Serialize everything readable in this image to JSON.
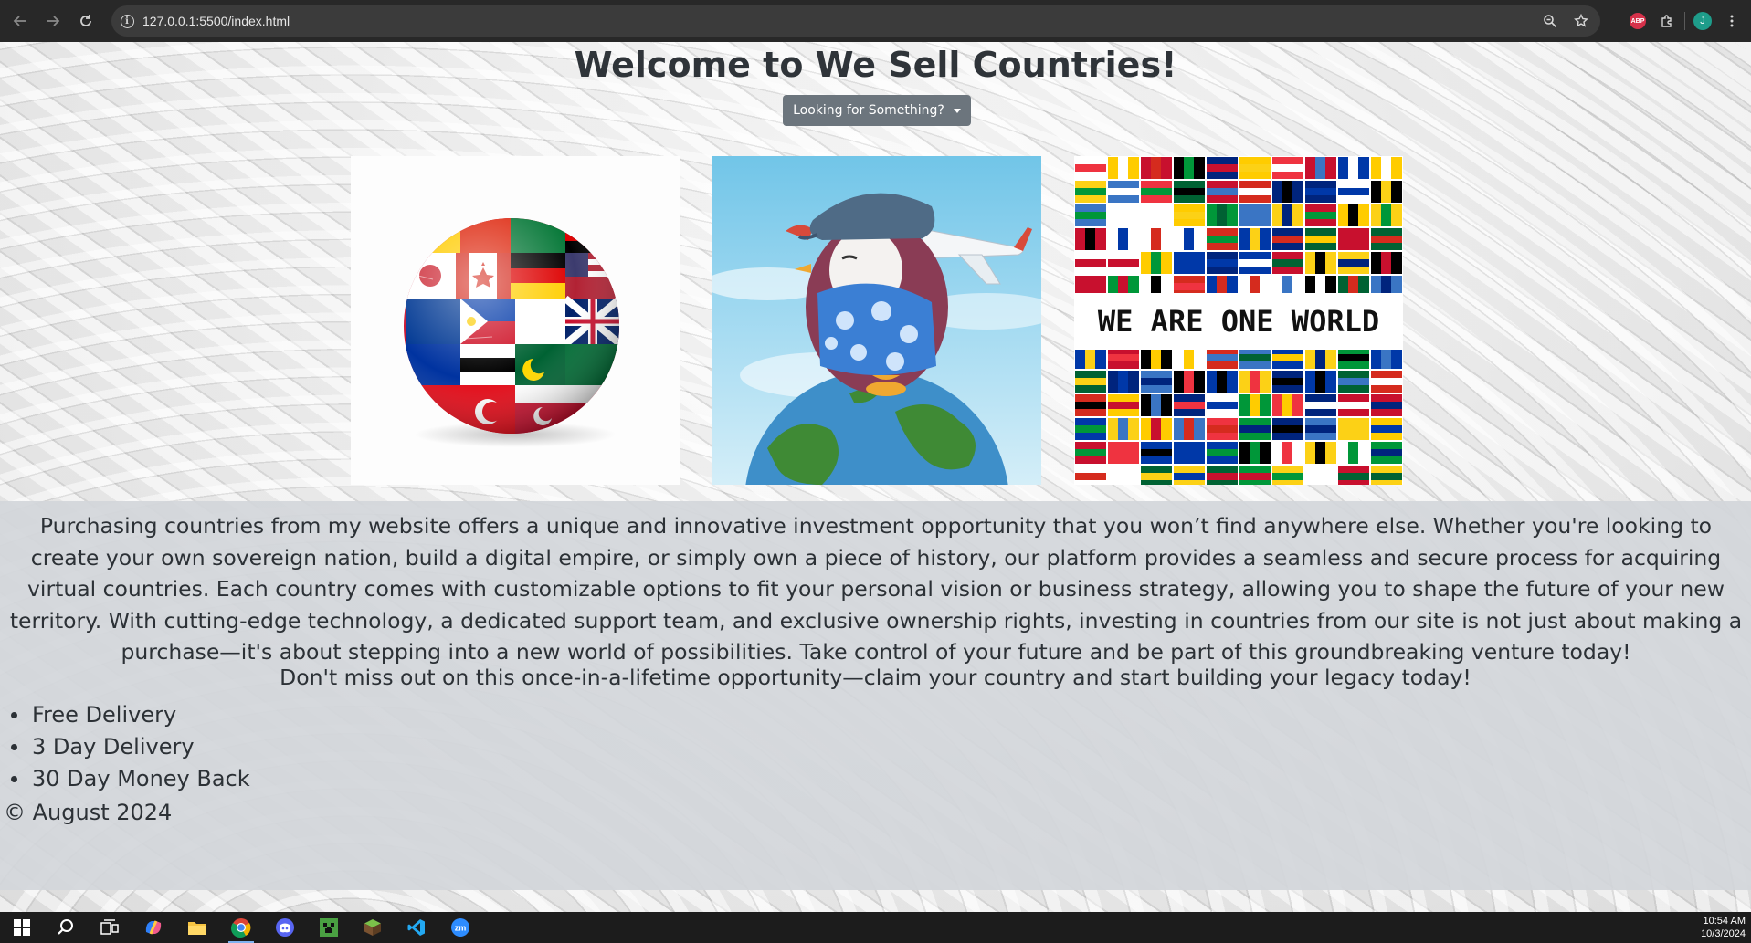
{
  "browser": {
    "url": "127.0.0.1:5500/index.html",
    "icons": [
      "back-icon",
      "forward-icon",
      "reload-icon",
      "site-info-icon",
      "zoom-icon",
      "bookmark-star-icon",
      "adblock-icon",
      "extensions-icon",
      "profile-avatar",
      "menu-icon"
    ],
    "abp_label": "ABP",
    "profile_initial": "J"
  },
  "page": {
    "title": "Welcome to We Sell Countries!",
    "dropdown_label": "Looking for Something?",
    "images": [
      {
        "name": "flag-globe-image"
      },
      {
        "name": "penguin-on-globe-image"
      },
      {
        "name": "we-are-one-world-image",
        "text": "WE ARE ONE WORLD"
      }
    ],
    "description": "Purchasing countries from my website offers a unique and innovative investment opportunity that you won’t find anywhere else. Whether you're looking to create your own sovereign nation, build a digital empire, or simply own a piece of history, our platform provides a seamless and secure process for acquiring virtual countries. Each country comes with customizable options to fit your personal vision or business strategy, allowing you to shape the future of your new territory. With cutting-edge technology, a dedicated support team, and exclusive ownership rights, investing in countries from our site is not just about making a purchase—it's about stepping into a new world of possibilities. Take control of your future and be part of this groundbreaking venture today!",
    "cta": "Don't miss out on this once-in-a-lifetime opportunity—claim your country and start building your legacy today!",
    "features": [
      "Free Delivery",
      "3 Day Delivery",
      "30 Day Money Back"
    ],
    "footer": "© August 2024"
  },
  "taskbar": {
    "apps": [
      "windows-start",
      "search",
      "task-view",
      "copilot",
      "file-explorer",
      "chrome",
      "discord",
      "minecraft",
      "minecraft-launcher",
      "vscode",
      "zoom"
    ],
    "time": "10:54 AM",
    "date": "10/3/2024"
  },
  "colors": {
    "button": "#6c757d",
    "text": "#2c3136",
    "chrome_bg": "#282828"
  }
}
